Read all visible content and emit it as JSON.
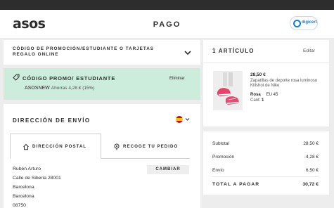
{
  "header": {
    "logo": "asos",
    "title": "PAGO",
    "trust_badge": "digicert"
  },
  "promo_section": {
    "title": "CÓDIGO DE PROMOCIÓN/ESTUDIANTE O TARJETAS REGALO ONLINE"
  },
  "applied_promo": {
    "title": "CÓDIGO PROMO/ ESTUDIANTE",
    "remove_label": "Eliminar",
    "code": "ASOSNEW",
    "savings": "Ahorras 4,28 € (15%)"
  },
  "shipping": {
    "title": "DIRECCIÓN DE ENVÍO",
    "tabs": [
      {
        "label": "DIRECCIÓN POSTAL",
        "icon": "home-icon",
        "active": true
      },
      {
        "label": "RECOGE TU PEDIDO",
        "icon": "location-pin-icon",
        "active": false
      }
    ],
    "change_label": "CAMBIAR",
    "address": [
      "Rubén Arturo",
      "Calle de Siberia 28001",
      "Barcelona",
      "Barcelona",
      "08750"
    ]
  },
  "order": {
    "title": "1 ARTÍCULO",
    "edit_label": "Editar",
    "item": {
      "price": "28,50 €",
      "description": "Zapatillas de deporte rosa luminoso Killshot de Nike",
      "color": "Rosa",
      "size": "EU 45",
      "qty_label": "Cant:",
      "qty": "1"
    }
  },
  "totals": {
    "rows": [
      {
        "label": "Subtotal",
        "value": "28,50 €"
      },
      {
        "label": "Promoción",
        "value": "-4,28 €"
      },
      {
        "label": "Envío",
        "value": "6,50 €"
      }
    ],
    "total_label": "TOTAL A PAGAR",
    "total_value": "30,72 €"
  },
  "colors": {
    "header_bar": "#2d2d2d",
    "promo_applied_bg": "#ccecdc",
    "page_bg": "#ededed"
  }
}
